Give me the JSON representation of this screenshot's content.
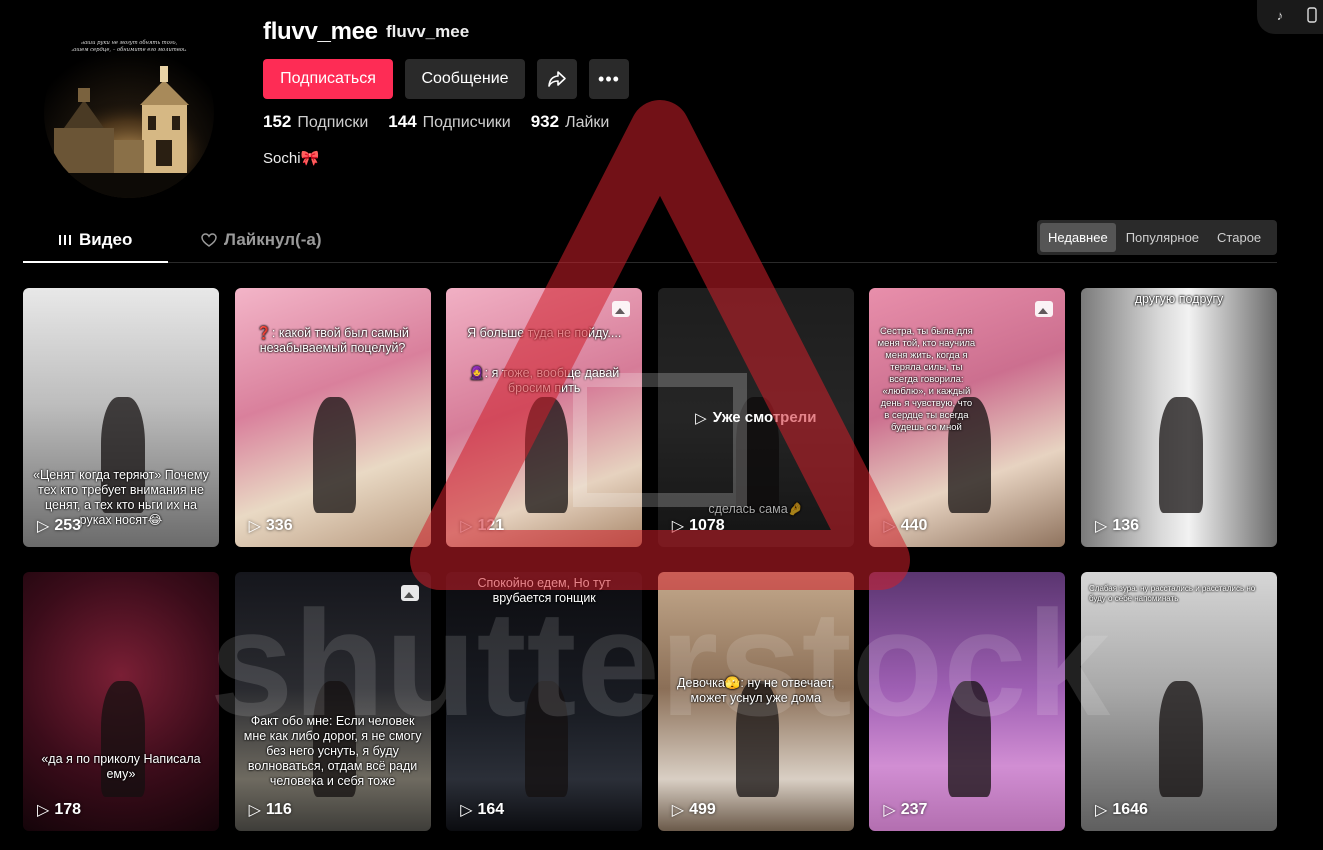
{
  "profile": {
    "username": "fluvv_mee",
    "nickname": "fluvv_mee",
    "bio": "Sochi🎀",
    "avatar_caption": "Когда ваши руки не могут обнять того, кто в вашем сердце, – обнимите его молитвой."
  },
  "actions": {
    "follow": "Подписаться",
    "message": "Сообщение"
  },
  "stats": [
    {
      "value": "152",
      "label": "Подписки"
    },
    {
      "value": "144",
      "label": "Подписчики"
    },
    {
      "value": "932",
      "label": "Лайки"
    }
  ],
  "tabs": {
    "videos": "Видео",
    "liked": "Лайкнул(-а)"
  },
  "sort": [
    "Недавнее",
    "Популярное",
    "Старое"
  ],
  "videos": [
    {
      "views": "253",
      "caption": "«Ценят когда теряют» Почему тех кто требует внимания не ценят, а тех кто ньги их на руках носят😂",
      "bg": "bw"
    },
    {
      "views": "336",
      "caption": "❓: какой твой был самый незабываемый поцелуй?",
      "bg": "pink"
    },
    {
      "views": "121",
      "caption": "Я больше туда не пойду....",
      "caption2": "🧕: я тоже, вообще давай бросим пить",
      "bg": "pink2",
      "photo": true
    },
    {
      "views": "1078",
      "caption": "сделась сама🤌",
      "bg": "dark",
      "watched": "Уже смотрели"
    },
    {
      "views": "440",
      "caption": "Сестра, ты была для меня той, кто научила меня жить, когда я теряла силы, ты всегда говорила: «люблю», и каждый день я чувствую, что в сердце ты всегда будешь со мной",
      "bg": "pink3",
      "photo": true
    },
    {
      "views": "136",
      "caption": "другую подругу",
      "bg": "wall"
    },
    {
      "views": "178",
      "caption": "«да я по приколу Написала ему»",
      "bg": "red"
    },
    {
      "views": "116",
      "caption": "Факт обо мне: Если человек мне как либо дорог, я не смогу без него уснуть, я буду волноваться, отдам всё ради человека и себя тоже",
      "bg": "night",
      "photo": true
    },
    {
      "views": "164",
      "caption": "Спокойно едем, Но тут врубается гонщик",
      "bg": "car"
    },
    {
      "views": "499",
      "caption": "Девочка🫣: ну не отвечает, может уснул уже дома",
      "bg": "room"
    },
    {
      "views": "237",
      "caption": "",
      "bg": "purple"
    },
    {
      "views": "1646",
      "caption": "Слабая зура: ну расстались и расстались но буду о себе напоминать",
      "bg": "lift"
    }
  ],
  "watermark": "shutterstock",
  "colors": {
    "accent": "#fe2c55",
    "surface": "#2a2a2a",
    "background": "#000000"
  }
}
